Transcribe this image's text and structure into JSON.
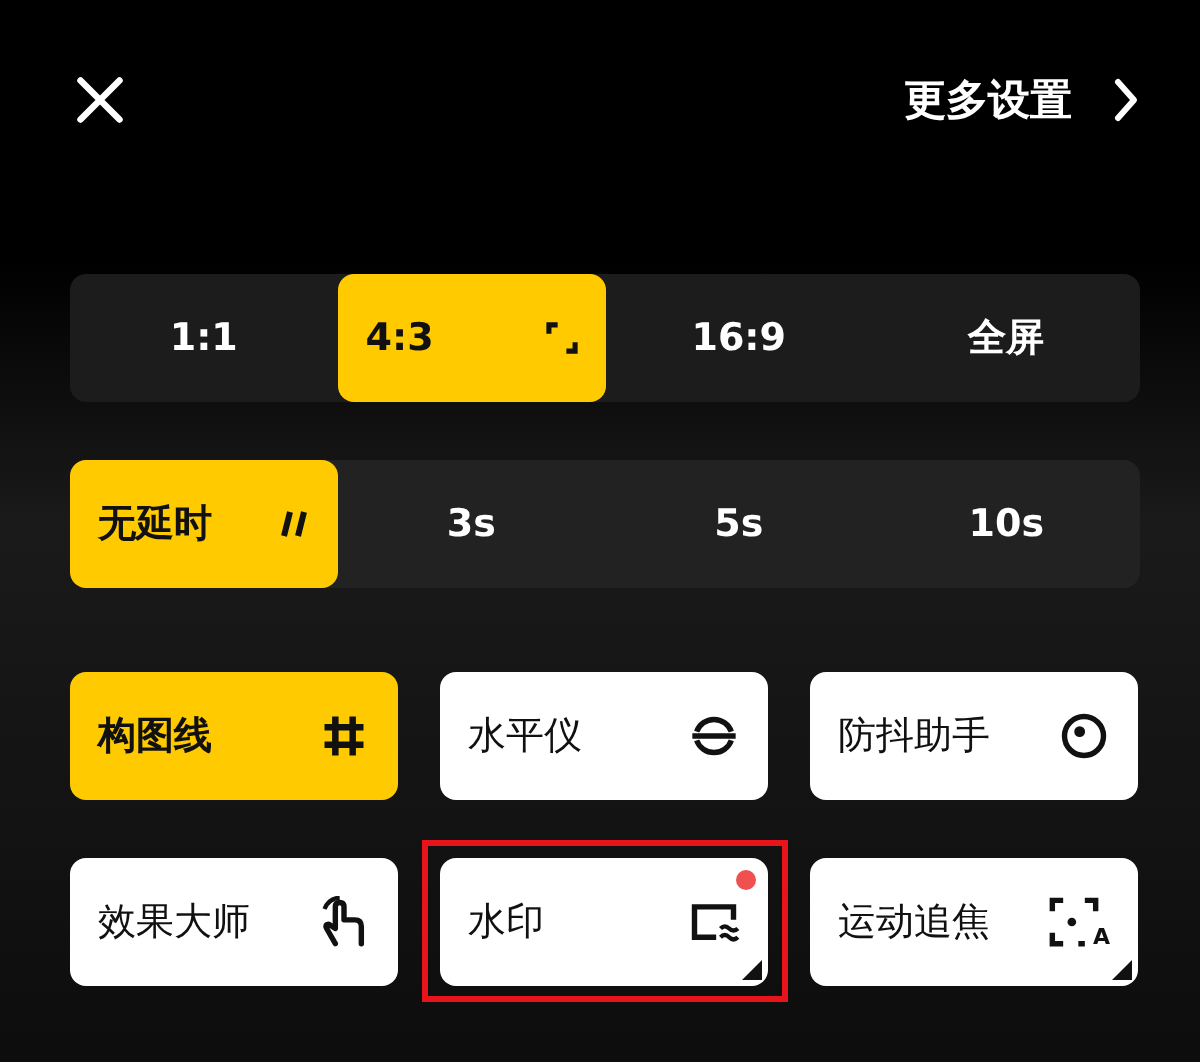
{
  "header": {
    "more_settings": "更多设置"
  },
  "aspect_ratios": [
    {
      "label": "1:1",
      "selected": false
    },
    {
      "label": "4:3",
      "selected": true
    },
    {
      "label": "16:9",
      "selected": false
    },
    {
      "label": "全屏",
      "selected": false
    }
  ],
  "timer": [
    {
      "label": "无延时",
      "selected": true
    },
    {
      "label": "3s",
      "selected": false
    },
    {
      "label": "5s",
      "selected": false
    },
    {
      "label": "10s",
      "selected": false
    }
  ],
  "tiles": [
    {
      "label": "构图线",
      "kind": "grid",
      "selected": true,
      "badge": false,
      "menu": false,
      "highlighted": false
    },
    {
      "label": "水平仪",
      "kind": "level",
      "selected": false,
      "badge": false,
      "menu": false,
      "highlighted": false
    },
    {
      "label": "防抖助手",
      "kind": "stabilizer",
      "selected": false,
      "badge": false,
      "menu": false,
      "highlighted": false
    },
    {
      "label": "效果大师",
      "kind": "gesture",
      "selected": false,
      "badge": false,
      "menu": false,
      "highlighted": false
    },
    {
      "label": "水印",
      "kind": "watermark",
      "selected": false,
      "badge": true,
      "menu": true,
      "highlighted": true
    },
    {
      "label": "运动追焦",
      "kind": "tracking",
      "icon_letter": "A",
      "selected": false,
      "badge": false,
      "menu": true,
      "highlighted": false
    }
  ]
}
